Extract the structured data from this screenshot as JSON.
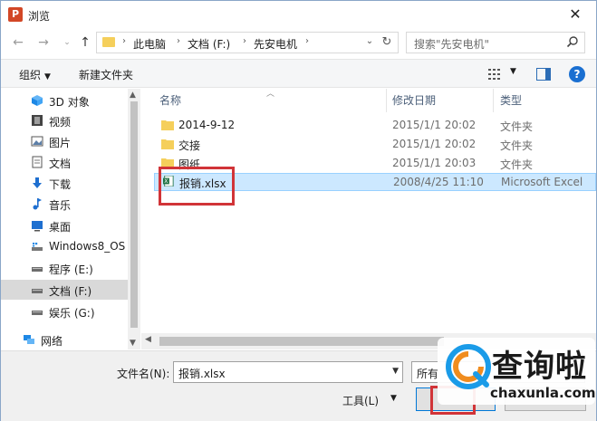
{
  "window": {
    "title": "浏览",
    "app_icon_letter": "P"
  },
  "nav": {
    "breadcrumbs": [
      "此电脑",
      "文档 (F:)",
      "先安电机"
    ],
    "search_placeholder": "搜索\"先安电机\""
  },
  "toolbar": {
    "organize": "组织",
    "new_folder": "新建文件夹"
  },
  "sidebar": {
    "items": [
      {
        "label": "3D 对象",
        "icon": "3d-objects-icon"
      },
      {
        "label": "视频",
        "icon": "video-icon"
      },
      {
        "label": "图片",
        "icon": "pictures-icon"
      },
      {
        "label": "文档",
        "icon": "documents-icon"
      },
      {
        "label": "下载",
        "icon": "download-icon"
      },
      {
        "label": "音乐",
        "icon": "music-icon"
      },
      {
        "label": "桌面",
        "icon": "desktop-icon"
      },
      {
        "label": "Windows8_OS",
        "icon": "os-drive-icon"
      },
      {
        "label": "程序 (E:)",
        "icon": "drive-icon"
      },
      {
        "label": "文档 (F:)",
        "icon": "drive-icon",
        "selected": true
      },
      {
        "label": "娱乐 (G:)",
        "icon": "drive-icon"
      },
      {
        "label": "网络",
        "icon": "network-icon"
      }
    ]
  },
  "columns": {
    "name": "名称",
    "modified": "修改日期",
    "type": "类型"
  },
  "files": [
    {
      "name": "2014-9-12",
      "date": "2015/1/1 20:02",
      "type": "文件夹",
      "icon": "folder-icon"
    },
    {
      "name": "交接",
      "date": "2015/1/1 20:02",
      "type": "文件夹",
      "icon": "folder-icon"
    },
    {
      "name": "图纸",
      "date": "2015/1/1 20:03",
      "type": "文件夹",
      "icon": "folder-icon"
    },
    {
      "name": "报销.xlsx",
      "date": "2008/4/25 11:10",
      "type": "Microsoft Excel",
      "icon": "excel-file-icon",
      "selected": true
    }
  ],
  "bottom": {
    "filename_label": "文件名(N):",
    "filename_value": "报销.xlsx",
    "filter_value": "所有",
    "tools_label": "工具(L)"
  },
  "watermark": {
    "name": "查询啦",
    "url": "chaxunla.com"
  },
  "colors": {
    "accent": "#0078d7",
    "highlight": "#d13438",
    "selection": "#cce8ff",
    "folder": "#f5cf5b"
  }
}
